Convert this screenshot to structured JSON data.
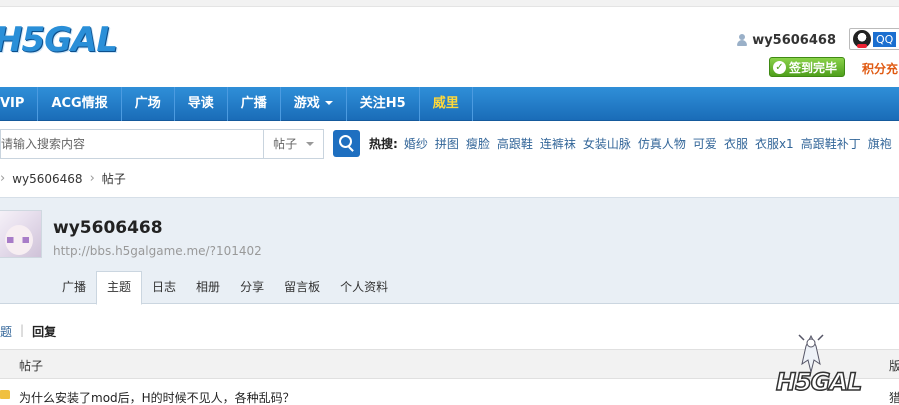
{
  "header": {
    "logo_text": "H5GAL",
    "username": "wy5606468",
    "qq_label": "QQ",
    "checkin_label": "签到完毕",
    "points_label": "积分充"
  },
  "nav": {
    "items": [
      {
        "label": "VIP",
        "dropdown": false,
        "highlight": false
      },
      {
        "label": "ACG情报",
        "dropdown": false,
        "highlight": false
      },
      {
        "label": "广场",
        "dropdown": false,
        "highlight": false
      },
      {
        "label": "导读",
        "dropdown": false,
        "highlight": false
      },
      {
        "label": "广播",
        "dropdown": false,
        "highlight": false
      },
      {
        "label": "游戏",
        "dropdown": true,
        "highlight": false
      },
      {
        "label": "关注H5",
        "dropdown": false,
        "highlight": false
      },
      {
        "label": "威里",
        "dropdown": false,
        "highlight": true
      }
    ]
  },
  "search": {
    "placeholder": "请输入搜索内容",
    "type": "帖子",
    "hot_label": "热搜:",
    "hot_tags": [
      "婚纱",
      "拼图",
      "瘦脸",
      "高跟鞋",
      "连裤袜",
      "女装山脉",
      "仿真人物",
      "可爱",
      "衣服",
      "衣服x1",
      "高跟鞋补丁",
      "旗袍"
    ]
  },
  "breadcrumb": [
    "wy5606468",
    "帖子"
  ],
  "profile": {
    "name": "wy5606468",
    "url": "http://bbs.h5galgame.me/?101402",
    "tabs": [
      {
        "label": "广播",
        "active": false
      },
      {
        "label": "主题",
        "active": true
      },
      {
        "label": "日志",
        "active": false
      },
      {
        "label": "相册",
        "active": false
      },
      {
        "label": "分享",
        "active": false
      },
      {
        "label": "留言板",
        "active": false
      },
      {
        "label": "个人资料",
        "active": false
      }
    ]
  },
  "subtabs": {
    "topic": "题",
    "sep": "|",
    "reply": "回复"
  },
  "table": {
    "col_post": "帖子",
    "col_right": "版",
    "rows": [
      {
        "title": "为什么安装了mod后，H的时候不见人，各种乱码？",
        "right": "猎"
      }
    ]
  },
  "watermark": {
    "text": "H5GAL"
  },
  "colors": {
    "nav_blue": "#1a6cb8",
    "link": "#336699",
    "checkin_green": "#4f9f1c",
    "points_orange": "#e05a12",
    "nav_highlight": "#ffd83a"
  }
}
